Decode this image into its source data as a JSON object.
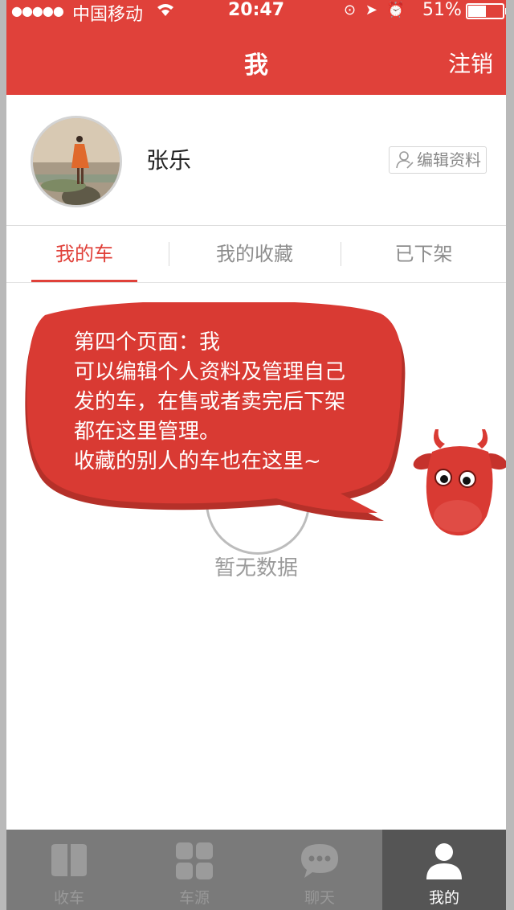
{
  "status_bar": {
    "signal": "●●●●●",
    "carrier": "中国移动",
    "time": "20:47",
    "battery": "51%",
    "battery_level": 0.51
  },
  "header": {
    "title": "我",
    "logout_label": "注销"
  },
  "profile": {
    "name": "张乐",
    "edit_label": "编辑资料"
  },
  "tabs": [
    {
      "label": "我的车",
      "active": true
    },
    {
      "label": "我的收藏",
      "active": false
    },
    {
      "label": "已下架",
      "active": false
    }
  ],
  "empty": {
    "text": "暂无数据"
  },
  "tooltip": {
    "lines": [
      "第四个页面：我",
      "可以编辑个人资料及管理自己",
      "发的车，在售或者卖完后下架",
      "都在这里管理。",
      "收藏的别人的车也在这里~"
    ]
  },
  "tabbar": {
    "items": [
      {
        "label": "收车",
        "icon": "book-icon",
        "active": false
      },
      {
        "label": "车源",
        "icon": "grid-icon",
        "active": false
      },
      {
        "label": "聊天",
        "icon": "chat-bubble-icon",
        "active": false
      },
      {
        "label": "我的",
        "icon": "person-icon",
        "active": true
      }
    ]
  },
  "colors": {
    "accent": "#e0413a",
    "bubble": "#d93a33",
    "tabbar": "#7a7a7a",
    "tabbar_active": "#555555"
  }
}
